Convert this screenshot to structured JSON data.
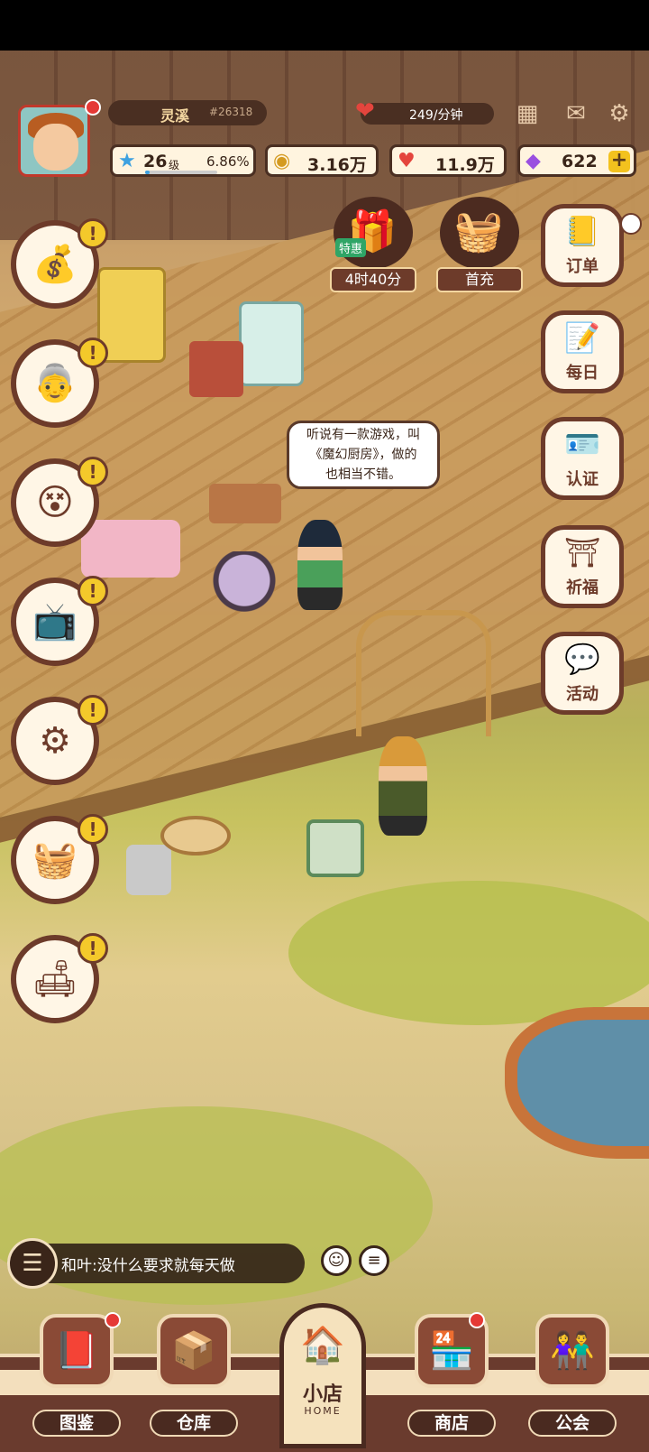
{
  "player": {
    "name": "灵溪",
    "id": "#26318",
    "level": "26",
    "level_unit": "级",
    "level_progress": "6.86%",
    "level_progress_fraction": 0.0686
  },
  "income": {
    "rate": "249/分钟"
  },
  "resources": {
    "coins": "3.16万",
    "hearts": "11.9万",
    "gems": "622"
  },
  "promos": [
    {
      "tag": "特惠",
      "caption": "4时40分",
      "icon": "gift-box-icon"
    },
    {
      "caption": "首充",
      "icon": "gift-basket-icon"
    }
  ],
  "right_menu": [
    {
      "label": "订单",
      "icon": "order-book-icon"
    },
    {
      "label": "每日",
      "icon": "daily-notepad-icon"
    },
    {
      "label": "认证",
      "icon": "id-card-icon"
    },
    {
      "label": "祈福",
      "icon": "pray-statue-icon"
    },
    {
      "label": "活动",
      "icon": "event-bubbles-icon"
    }
  ],
  "left_menu": [
    {
      "icon": "money-bag-icon",
      "alert": "!"
    },
    {
      "icon": "grandma-avatar-icon",
      "alert": "!"
    },
    {
      "icon": "dizzy-grandma-avatar-icon",
      "alert": "!"
    },
    {
      "icon": "tv-video-icon",
      "alert": "!"
    },
    {
      "icon": "machine-icon",
      "alert": "!"
    },
    {
      "icon": "basket-icon",
      "alert": "!"
    },
    {
      "icon": "armchair-icon",
      "alert": "!"
    }
  ],
  "speech_bubble": {
    "line1": "听说有一款游戏，叫",
    "line2": "《魔幻厨房》，做的",
    "line3": "也相当不错。"
  },
  "chat": {
    "message": "和叶:没什么要求就每天做"
  },
  "nav": {
    "items": [
      {
        "label": "图鉴",
        "icon": "book-icon",
        "has_dot": true
      },
      {
        "label": "仓库",
        "icon": "box-icon",
        "has_dot": false
      },
      {
        "label": "商店",
        "icon": "shop-icon",
        "has_dot": true
      },
      {
        "label": "公会",
        "icon": "guild-kids-icon",
        "has_dot": false
      }
    ],
    "home_label": "小店",
    "home_sub": "HOME"
  },
  "colors": {
    "frame_brown": "#6d3b2a",
    "cream": "#fff6e6",
    "alert_yellow": "#f4c92b",
    "badge_red": "#e53935"
  }
}
